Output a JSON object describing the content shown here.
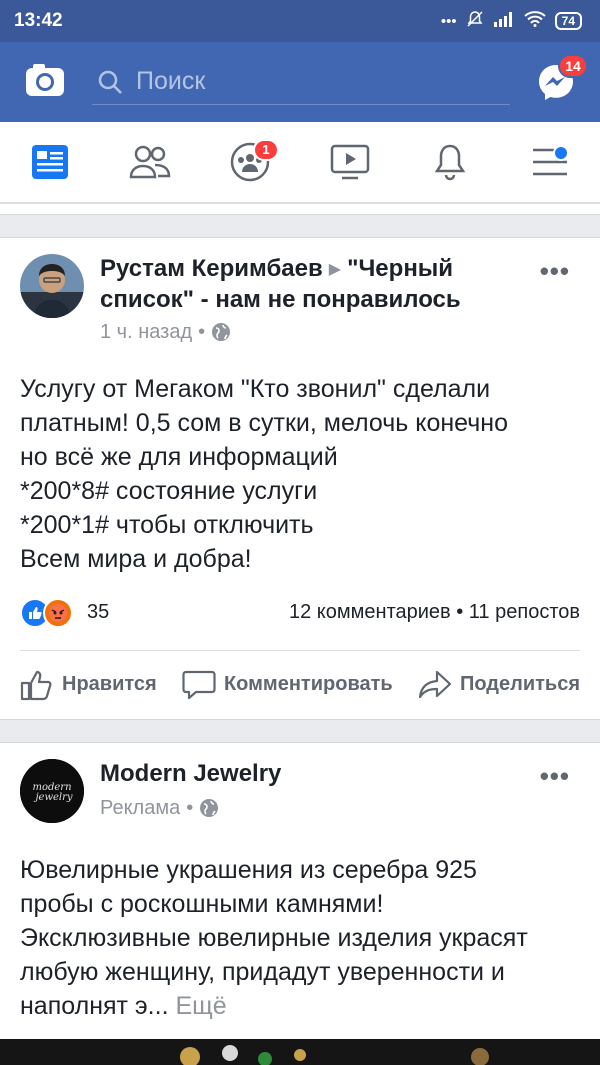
{
  "status": {
    "time": "13:42",
    "battery": "74"
  },
  "topbar": {
    "search_placeholder": "Поиск",
    "messenger_badge": "14"
  },
  "nav": {
    "groups_badge": "1"
  },
  "post1": {
    "author": "Рустам Керимбаев",
    "target": "\"Черный список\" - нам не понравилось",
    "time": "1 ч. назад",
    "lines": [
      "Услугу от Мегаком \"Кто звонил\" сделали",
      "платным! 0,5 сом в сутки, мелочь конечно",
      "но всё же для информаций",
      "*200*8# состояние услуги",
      "*200*1# чтобы отключить",
      "Всем мира и добра!"
    ],
    "reactions_count": "35",
    "comments": "12 комментариев",
    "shares": "11 репостов"
  },
  "actions": {
    "like": "Нравится",
    "comment": "Комментировать",
    "share": "Поделиться"
  },
  "post2": {
    "author": "Modern Jewelry",
    "meta": "Реклама",
    "logo_text": "modern jewelry",
    "lines": [
      "Ювелирные украшения из серебра 925",
      "пробы с роскошными камнями!",
      "Эксклюзивные ювелирные изделия украсят",
      "любую женщину, придадут уверенности и"
    ],
    "last_line": "наполнят э...",
    "more": "Ещё"
  }
}
